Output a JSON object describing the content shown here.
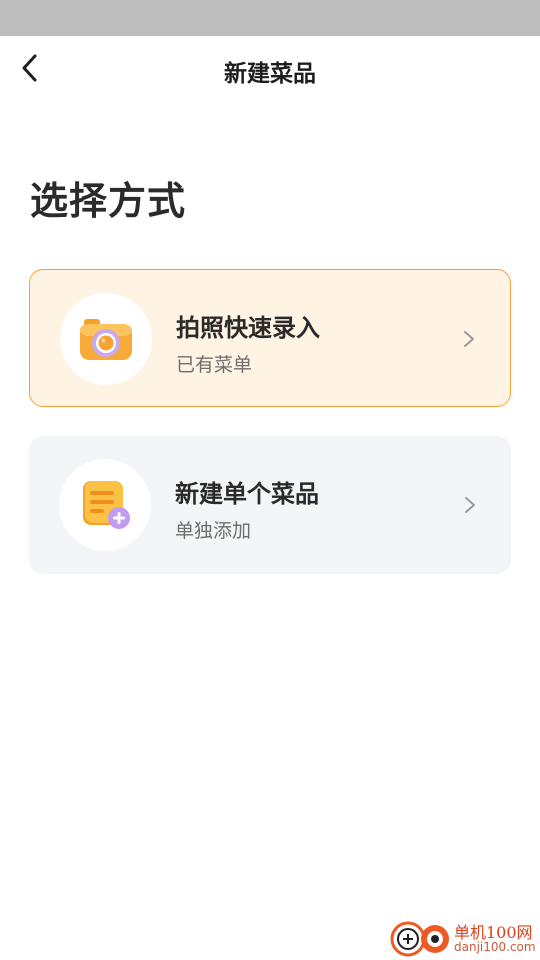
{
  "nav": {
    "title": "新建菜品"
  },
  "section": {
    "title": "选择方式"
  },
  "options": [
    {
      "title": "拍照快速录入",
      "subtitle": "已有菜单",
      "icon": "camera-icon"
    },
    {
      "title": "新建单个菜品",
      "subtitle": "单独添加",
      "icon": "add-document-icon"
    }
  ],
  "watermark": {
    "name": "单机100网",
    "url": "danji100.com"
  },
  "colors": {
    "accent": "#f2a23c",
    "highlight_bg": "#fff3e4",
    "card_bg": "#f4f5f9",
    "status_bar": "#bdbdbd"
  }
}
